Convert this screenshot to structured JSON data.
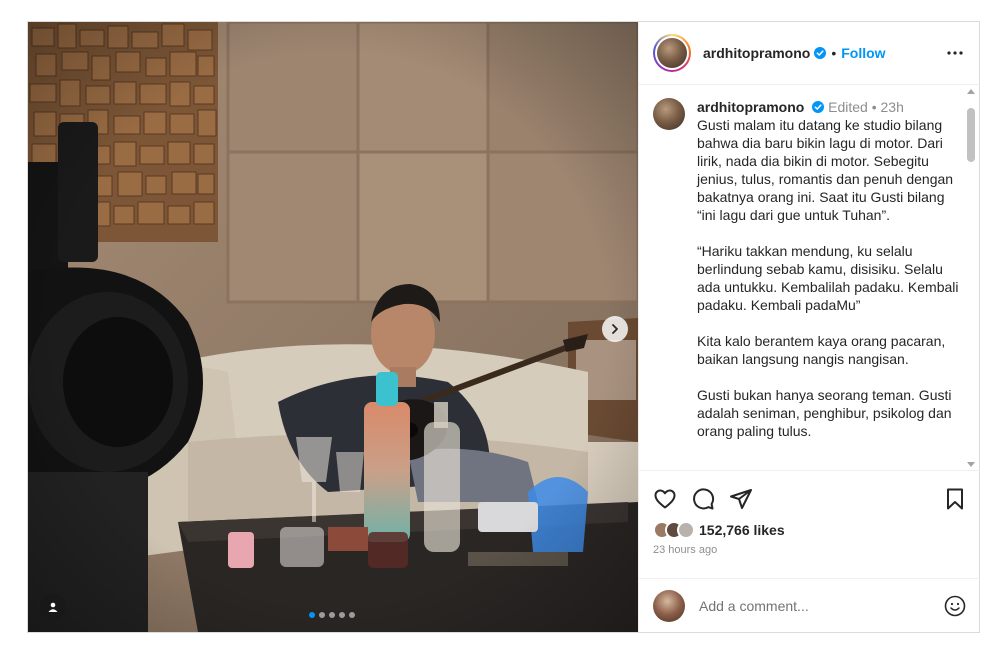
{
  "post": {
    "username": "ardhitopramono",
    "follow_label": "Follow",
    "header_separator": "•",
    "caption": {
      "username": "ardhitopramono",
      "meta": "Edited • 23h",
      "paragraphs": [
        "Gusti malam itu datang ke studio bilang bahwa dia baru bikin lagu di motor. Dari lirik, nada dia bikin di motor. Sebegitu jenius, tulus, romantis dan penuh dengan bakatnya orang ini. Saat itu Gusti bilang “ini lagu dari gue untuk Tuhan”.",
        "“Hariku takkan mendung, ku selalu berlindung sebab kamu, disisiku. Selalu ada untukku. Kembalilah padaku. Kembali padaku. Kembali padaMu”",
        "Kita kalo berantem kaya orang pacaran, baikan langsung nangis nangisan.",
        "Gusti bukan hanya seorang teman. Gusti adalah seniman, penghibur, psikolog dan orang paling tulus."
      ]
    },
    "likes": "152,766 likes",
    "time_ago": "23 hours ago",
    "comment_placeholder": "Add a comment...",
    "carousel": {
      "total": 5,
      "active": 1
    },
    "colors": {
      "accent": "#0095f6",
      "text": "#262626",
      "muted": "#8e8e8e",
      "border": "#dbdbdb"
    },
    "icons": [
      "verified-badge-icon",
      "more-options-icon",
      "heart-icon",
      "comment-icon",
      "share-icon",
      "bookmark-icon",
      "chevron-right-icon",
      "user-tag-icon",
      "emoji-icon"
    ]
  }
}
